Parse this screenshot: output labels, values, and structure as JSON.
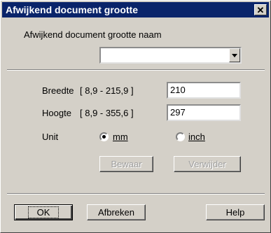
{
  "window": {
    "title": "Afwijkend document grootte",
    "close_glyph": "✕"
  },
  "name_section": {
    "label": "Afwijkend document grootte naam",
    "combo_value": ""
  },
  "breedte": {
    "label": "Breedte",
    "range": "[   8,9  -  215,9 ]",
    "value": "210"
  },
  "hoogte": {
    "label": "Hoogte",
    "range": "[   8,9  -  355,6 ]",
    "value": "297"
  },
  "unit": {
    "label": "Unit",
    "options": [
      {
        "label": "mm",
        "selected": true
      },
      {
        "label": "inch",
        "selected": false
      }
    ]
  },
  "actions": {
    "bewaar": "Bewaar",
    "verwijder": "Verwijder"
  },
  "footer": {
    "ok": "OK",
    "afbreken": "Afbreken",
    "help": "Help"
  },
  "colors": {
    "titlebar": "#0a246a",
    "face": "#d4d0c8"
  }
}
